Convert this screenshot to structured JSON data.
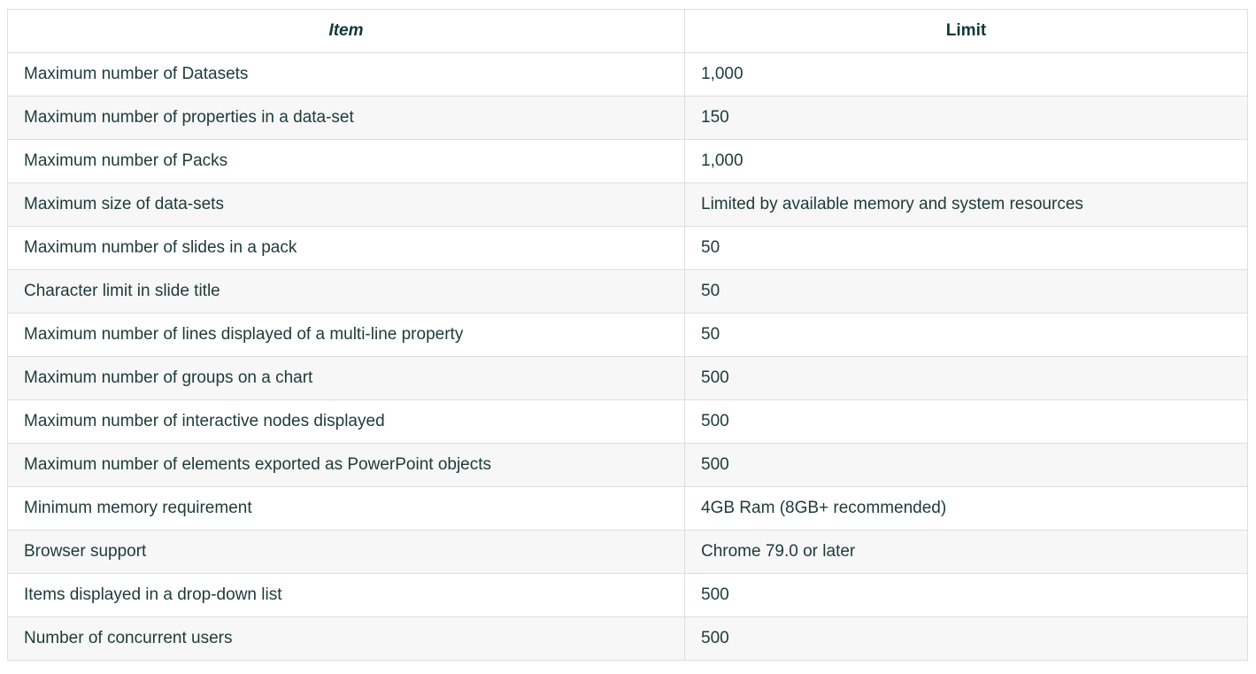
{
  "table": {
    "headers": {
      "item": "Item",
      "limit": "Limit"
    },
    "rows": [
      {
        "item": "Maximum number of Datasets",
        "limit": "1,000"
      },
      {
        "item": "Maximum number of properties in a data-set",
        "limit": "150"
      },
      {
        "item": "Maximum number of Packs",
        "limit": "1,000"
      },
      {
        "item": "Maximum size of data-sets",
        "limit": "Limited by available memory and system resources"
      },
      {
        "item": "Maximum number of slides in a pack",
        "limit": "50"
      },
      {
        "item": "Character limit in slide title",
        "limit": "50"
      },
      {
        "item": "Maximum number of lines displayed of a multi-line property",
        "limit": "50"
      },
      {
        "item": "Maximum number of groups on a chart",
        "limit": "500"
      },
      {
        "item": "Maximum number of interactive nodes displayed",
        "limit": "500"
      },
      {
        "item": "Maximum number of elements exported as PowerPoint objects",
        "limit": "500"
      },
      {
        "item": "Minimum memory requirement",
        "limit": "4GB Ram (8GB+ recommended)"
      },
      {
        "item": "Browser support",
        "limit": "Chrome 79.0 or later"
      },
      {
        "item": "Items displayed in a drop-down list",
        "limit": "500"
      },
      {
        "item": "Number of concurrent users",
        "limit": "500"
      }
    ]
  },
  "colors": {
    "text": "#1e3a3a",
    "border": "#dedede",
    "stripe": "#f7f7f7"
  }
}
